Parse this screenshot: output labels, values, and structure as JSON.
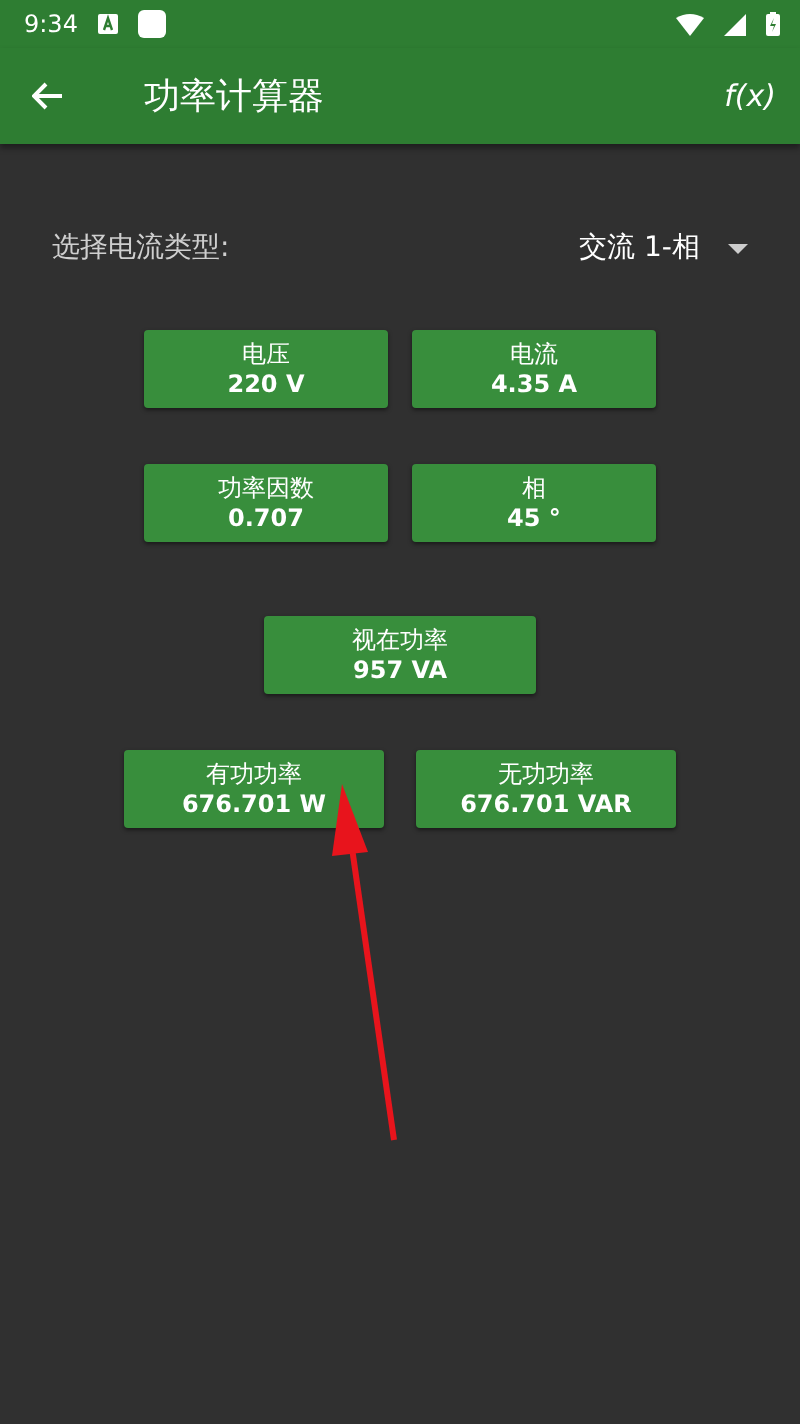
{
  "status_bar": {
    "time": "9:34"
  },
  "toolbar": {
    "title": "功率计算器",
    "action": "f(x)"
  },
  "current_type": {
    "label": "选择电流类型:",
    "value": "交流 1-相"
  },
  "rows": [
    [
      {
        "label": "电压",
        "value": "220 V"
      },
      {
        "label": "电流",
        "value": "4.35 A"
      }
    ],
    [
      {
        "label": "功率因数",
        "value": "0.707"
      },
      {
        "label": "相",
        "value": "45 °"
      }
    ],
    [
      {
        "label": "视在功率",
        "value": "957 VA"
      }
    ],
    [
      {
        "label": "有功功率",
        "value": "676.701 W"
      },
      {
        "label": "无功功率",
        "value": "676.701 VAR"
      }
    ]
  ]
}
